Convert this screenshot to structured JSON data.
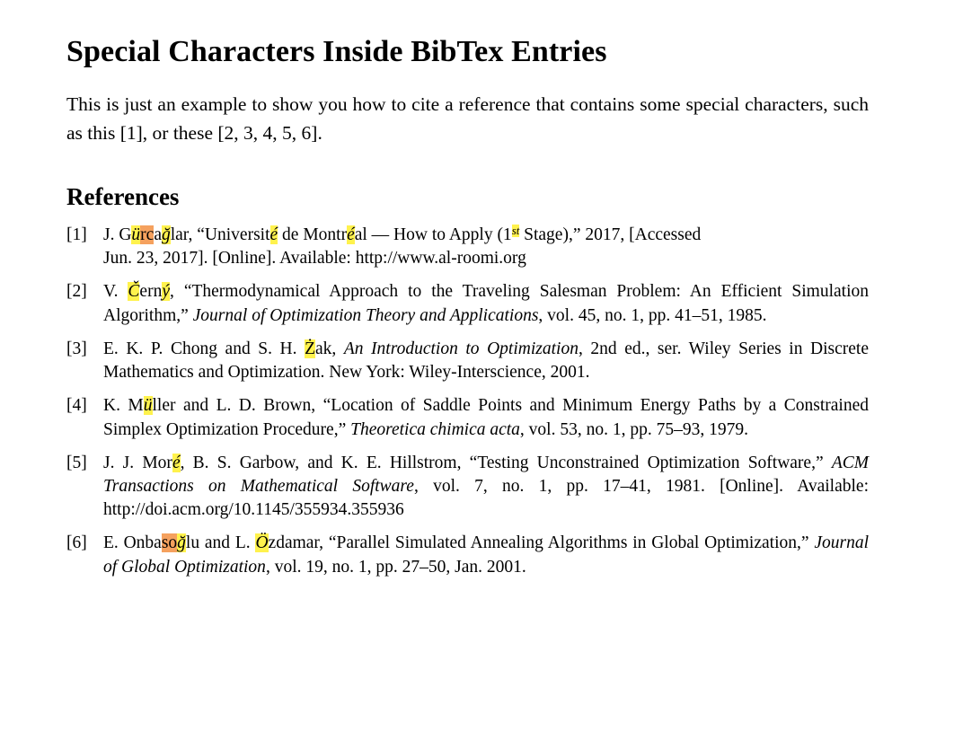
{
  "document": {
    "title": "Special Characters Inside BibTex Entries",
    "intro": "This is just an example to show you how to cite a reference that contains some special characters, such as this [1], or these [2, 3, 4, 5, 6].",
    "section_heading": "References"
  },
  "colors": {
    "highlight_yellow": "#fff24d",
    "highlight_orange": "#f5a15e",
    "text": "#000000",
    "page_background": "#ffffff"
  },
  "references": [
    {
      "label": "[1]",
      "number": "1",
      "text": "J. Gürcağlar, “Université de Montréal — How to Apply (1st Stage),” 2017, [Accessed Jun. 23, 2017]. [Online]. Available: http://www.al-roomi.org",
      "parts": {
        "author_prefix": "J. G",
        "author_hl_u": "ü",
        "author_hl_rc": "rc",
        "author_mid": "a",
        "author_hl_g": "ğ",
        "author_suffix": "lar, ",
        "title_open": "“Universit",
        "title_hl_e1": "é",
        "title_mid1": " de Montr",
        "title_hl_e2": "é",
        "title_mid2": "al — How to Apply (1",
        "title_hl_st": "st",
        "title_close": " Stage),” 2017, [Accessed",
        "line2": "Jun. 23, 2017]. [Online]. Available: http://www.al-roomi.org"
      }
    },
    {
      "label": "[2]",
      "number": "2",
      "text": "V. Černý, “Thermodynamical Approach to the Traveling Salesman Problem: An Efficient Simulation Algorithm,” Journal of Optimization Theory and Applications, vol. 45, no. 1, pp. 41–51, 1985.",
      "parts": {
        "author_prefix": "V. ",
        "author_hl_c": "Č",
        "author_mid": "ern",
        "author_hl_y": "ý",
        "author_suffix": ", ",
        "title": "“Thermodynamical Approach to the Traveling Salesman Problem:  An Efficient Simulation Algorithm,” ",
        "journal": "Journal of Optimization Theory and Applications",
        "tail": ", vol. 45, no. 1, pp. 41–51, 1985."
      }
    },
    {
      "label": "[3]",
      "number": "3",
      "text": "E. K. P. Chong and S. H. Żak, An Introduction to Optimization, 2nd ed., ser. Wiley Series in Discrete Mathematics and Optimization.  New York: Wiley-Interscience, 2001.",
      "parts": {
        "author_prefix": "E. K. P. Chong and S. H. ",
        "author_hl_z": "Ż",
        "author_suffix": "ak, ",
        "booktitle": "An Introduction to Optimization",
        "tail": ", 2nd ed., ser. Wiley Series in Discrete Mathematics and Optimization.   New York: Wiley-Interscience, 2001."
      }
    },
    {
      "label": "[4]",
      "number": "4",
      "text": "K. Müller and L. D. Brown, “Location of Saddle Points and Minimum Energy Paths by a Constrained Simplex Optimization Procedure,” Theoretica chimica acta, vol. 53, no. 1, pp. 75–93, 1979.",
      "parts": {
        "author_prefix": "K. M",
        "author_hl_u": "ü",
        "author_suffix": "ller and L. D. Brown, ",
        "title": "“Location of Saddle Points and Minimum Energy Paths by a Constrained Simplex Optimization Procedure,” ",
        "journal": "Theoretica chimica acta",
        "tail": ", vol. 53, no. 1, pp. 75–93, 1979."
      }
    },
    {
      "label": "[5]",
      "number": "5",
      "text": "J. J. Moré, B. S. Garbow, and K. E. Hillstrom, “Testing Unconstrained Optimization Software,” ACM Transactions on Mathematical Software, vol. 7, no. 1, pp. 17–41, 1981. [Online]. Available: http://doi.acm.org/10.1145/355934.355936",
      "parts": {
        "author_prefix": "J. J. Mor",
        "author_hl_e": "é",
        "author_suffix": ", B. S. Garbow, and K. E. Hillstrom, ",
        "title": "“Testing Unconstrained Optimization Software,” ",
        "journal": "ACM Transactions on Mathematical Software",
        "tail": ", vol. 7, no. 1, pp. 17–41, 1981. [Online]. Available: http://doi.acm.org/10.1145/355934.355936"
      }
    },
    {
      "label": "[6]",
      "number": "6",
      "text": "E. Onbasoğlu and L. Özdamar, “Parallel Simulated Annealing Algorithms in Global Optimization,” Journal of Global Optimization, vol. 19, no. 1, pp. 27–50, Jan. 2001.",
      "parts": {
        "author_prefix": "E. Onba",
        "author_hl_so": "so",
        "author_hl_g": "ğ",
        "author_mid": "lu and L. ",
        "author_hl_o": "Ö",
        "author_suffix": "zdamar, ",
        "title": "“Parallel Simulated Annealing Algorithms in Global Optimization,” ",
        "journal": "Journal of Global Optimization",
        "tail": ", vol. 19, no. 1, pp. 27–50, Jan. 2001."
      }
    }
  ]
}
